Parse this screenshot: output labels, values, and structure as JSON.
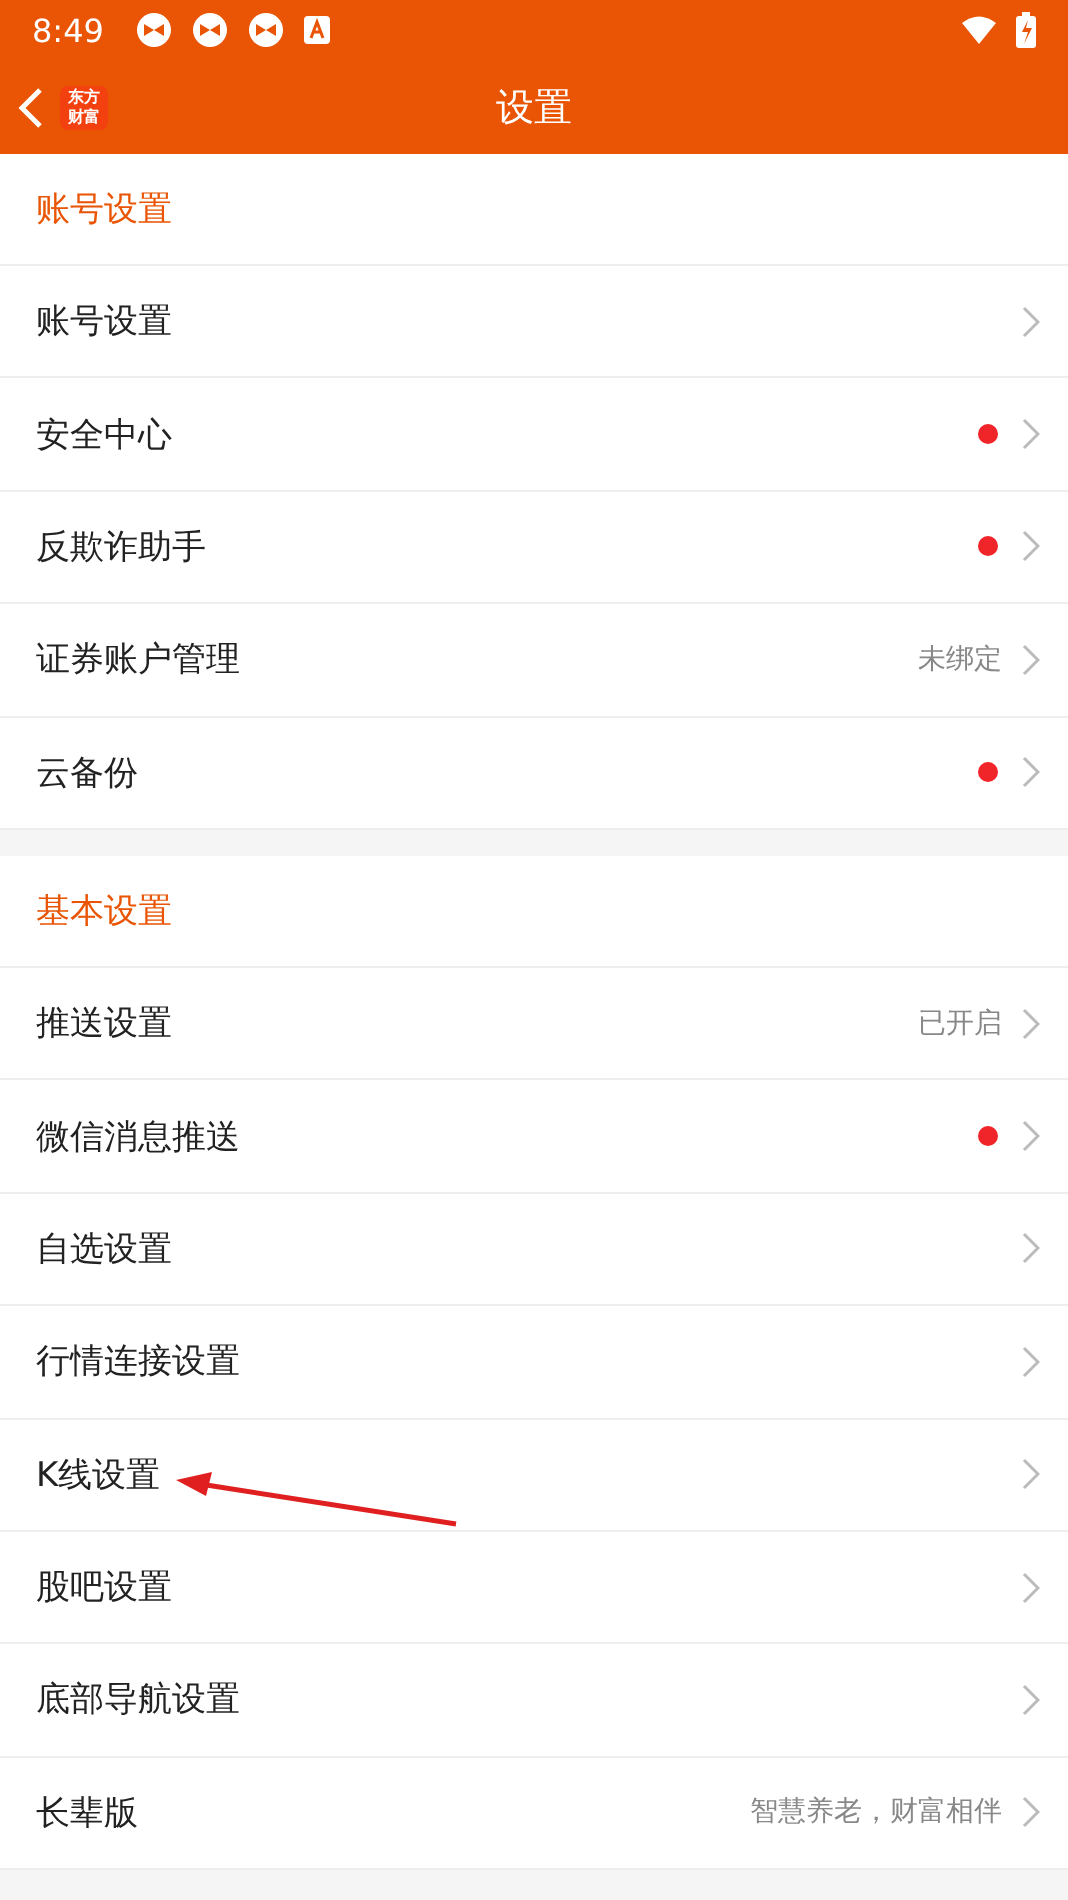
{
  "status_bar": {
    "time": "8:49"
  },
  "header": {
    "logo": [
      "东方",
      "财富"
    ],
    "title": "设置"
  },
  "sections": [
    {
      "title": "账号设置",
      "items": [
        {
          "label": "账号设置",
          "dot": false
        },
        {
          "label": "安全中心",
          "dot": true
        },
        {
          "label": "反欺诈助手",
          "dot": true
        },
        {
          "label": "证券账户管理",
          "dot": false,
          "value": "未绑定"
        },
        {
          "label": "云备份",
          "dot": true
        }
      ]
    },
    {
      "title": "基本设置",
      "items": [
        {
          "label": "推送设置",
          "dot": false,
          "value": "已开启"
        },
        {
          "label": "微信消息推送",
          "dot": true
        },
        {
          "label": "自选设置",
          "dot": false
        },
        {
          "label": "行情连接设置",
          "dot": false
        },
        {
          "label": "K线设置",
          "dot": false
        },
        {
          "label": "股吧设置",
          "dot": false
        },
        {
          "label": "底部导航设置",
          "dot": false
        },
        {
          "label": "长辈版",
          "dot": false,
          "value": "智慧养老，财富相伴"
        }
      ]
    }
  ]
}
